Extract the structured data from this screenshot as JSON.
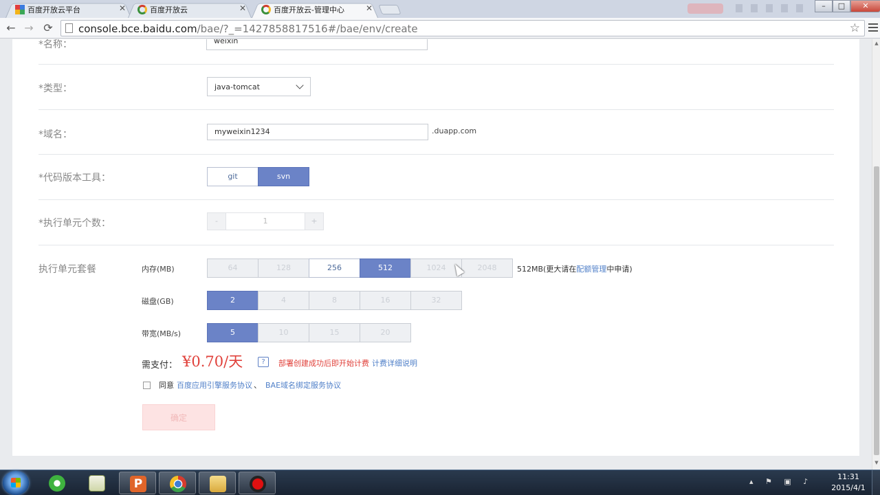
{
  "browser": {
    "tabs": [
      {
        "label": "百度开放云平台",
        "favicon": "baidu-grid-icon"
      },
      {
        "label": "百度开放云",
        "favicon": "chrome-ring-icon"
      },
      {
        "label": "百度开放云-管理中心",
        "favicon": "chrome-ring-icon",
        "active": true
      }
    ],
    "url_host": "console.bce.baidu.com",
    "url_path": "/bae/?_=1427858817516#/bae/env/create",
    "window_buttons": {
      "minimize": "–",
      "maximize": "□",
      "close": "✕"
    }
  },
  "form": {
    "name": {
      "label": "*名称：",
      "value": "weixin"
    },
    "type": {
      "label": "*类型：",
      "value": "java-tomcat"
    },
    "domain": {
      "label": "*域名：",
      "value": "myweixin1234",
      "suffix": ".duapp.com"
    },
    "vcs": {
      "label": "*代码版本工具：",
      "options": [
        "git",
        "svn"
      ],
      "selected": "svn"
    },
    "units": {
      "label": "*执行单元个数：",
      "minus": "-",
      "value": "1",
      "plus": "+"
    },
    "package": {
      "label": "执行单元套餐",
      "memory": {
        "label": "内存(MB)",
        "options": [
          "64",
          "128",
          "256",
          "512",
          "1024",
          "2048"
        ],
        "selected": "512",
        "disabled": [
          "64",
          "128",
          "1024",
          "2048"
        ],
        "note_prefix": "512MB(更大请在",
        "note_link": "配额管理",
        "note_suffix": "中申请)"
      },
      "disk": {
        "label": "磁盘(GB)",
        "options": [
          "2",
          "4",
          "8",
          "16",
          "32"
        ],
        "selected": "2",
        "disabled": [
          "4",
          "8",
          "16",
          "32"
        ]
      },
      "bandwidth": {
        "label": "带宽(MB/s)",
        "options": [
          "5",
          "10",
          "15",
          "20"
        ],
        "selected": "5",
        "disabled": [
          "10",
          "15",
          "20"
        ]
      }
    },
    "payment": {
      "label": "需支付：",
      "price": "¥0.70/天",
      "help": "?",
      "warning": "部署创建成功后即开始计费",
      "detail_link": "计费详细说明"
    },
    "agreement": {
      "prefix": "同意",
      "link1": "百度应用引擎服务协议",
      "separator": "、",
      "link2": "BAE域名绑定服务协议"
    },
    "submit_label": "确定"
  },
  "taskbar": {
    "clock_time": "11:31",
    "clock_date": "2015/4/1",
    "apps": [
      "ie-refresh-icon",
      "chart-app-icon",
      "powerpoint-icon",
      "chrome-icon",
      "explorer-folder-icon",
      "record-icon"
    ]
  },
  "colors": {
    "accent": "#6b83c7",
    "price": "#e0403a",
    "link": "#4f7fc8"
  }
}
